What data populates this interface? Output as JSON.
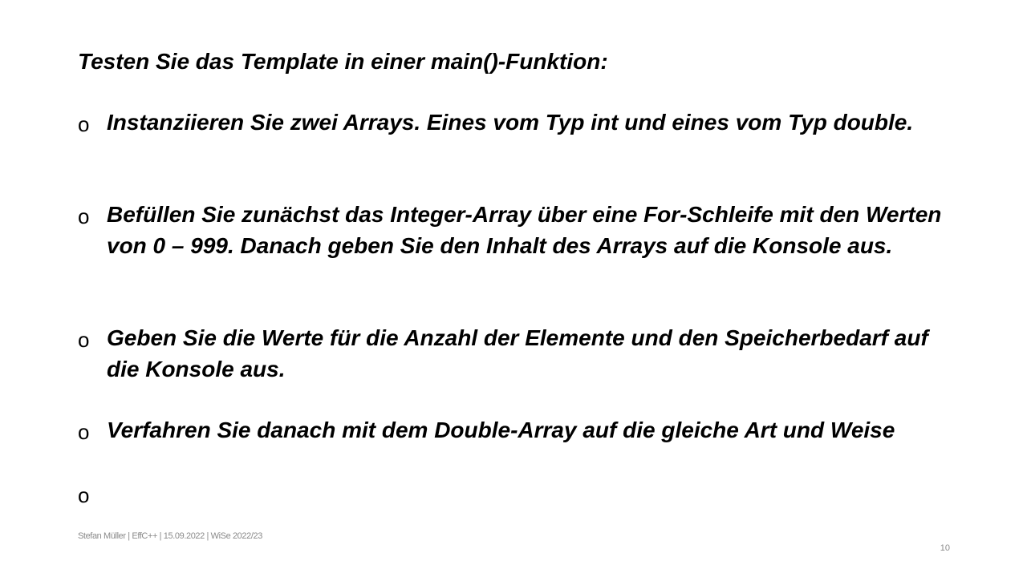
{
  "slide": {
    "heading": "Testen Sie das Template in einer main()-Funktion:",
    "bullet_symbol": "o",
    "bullets": [
      {
        "text": "Instanziieren Sie zwei Arrays. Eines vom Typ int und eines vom Typ double."
      },
      {
        "text": "Befüllen Sie zunächst das Integer-Array über eine For-Schleife mit den Werten von 0 – 999. Danach geben Sie den Inhalt des Arrays auf die Konsole aus."
      },
      {
        "text": "Geben Sie die Werte für die Anzahl der Elemente und den Speicherbedarf auf die Konsole aus."
      },
      {
        "text": "Verfahren Sie danach mit dem Double-Array auf die gleiche Art und Weise"
      },
      {
        "text": ""
      }
    ]
  },
  "footer": {
    "text": "Stefan Müller | EffC++ | 15.09.2022 | WiSe 2022/23",
    "page_number": "10"
  }
}
